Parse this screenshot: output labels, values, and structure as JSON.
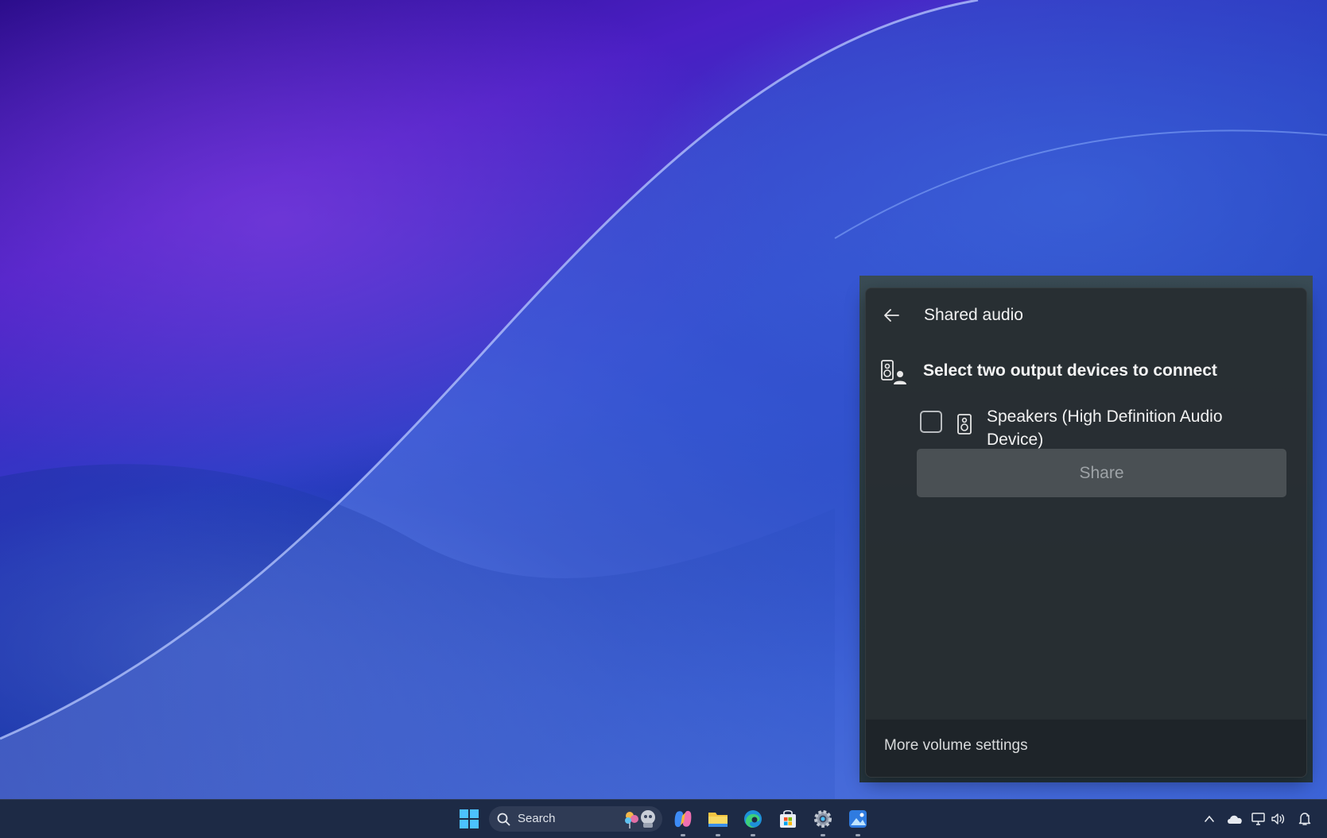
{
  "flyout": {
    "title": "Shared audio",
    "section_heading": "Select two output devices to connect",
    "device": {
      "label": "Speakers (High Definition Audio Device)",
      "checked": false
    },
    "share_button": "Share",
    "footer_link": "More volume settings"
  },
  "taskbar": {
    "search_label": "Search",
    "pinned_apps": [
      "start-icon",
      "copilot-icon",
      "file-explorer-icon",
      "edge-icon",
      "store-icon",
      "settings-icon",
      "photos-icon"
    ],
    "tray_icons": [
      "chevron-up-icon",
      "onedrive-icon",
      "network-icon",
      "volume-icon",
      "notification-icon"
    ]
  },
  "colors": {
    "flyout_bg": "#2e3438",
    "share_disabled": "#4a5054",
    "taskbar_bg": "#1d2a45"
  }
}
